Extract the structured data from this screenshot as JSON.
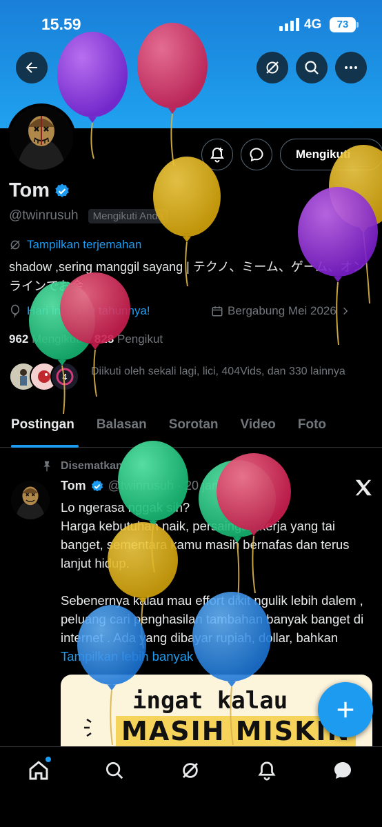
{
  "status_bar": {
    "time": "15.59",
    "network": "4G",
    "battery": "73"
  },
  "profile": {
    "name": "Tom",
    "handle": "@twinrusuh",
    "follows_you": "Mengikuti Anda",
    "follow_button": "Mengikuti",
    "translate": "Tampilkan terjemahan",
    "bio": "shadow ,sering manggil sayang | テクノ、ミーム、ゲーム、オンラインでお金",
    "birthday": "Hari ini ulang tahunnya!",
    "joined": "Bergabung Mei 2026",
    "following_count": "962",
    "following_label": "Mengikuti",
    "followers_count": "828",
    "followers_label": "Pengikut",
    "followed_by": "Diikuti oleh sekali lagi, lici, 404Vids, dan 330 lainnya"
  },
  "tabs": [
    {
      "label": "Postingan"
    },
    {
      "label": "Balasan"
    },
    {
      "label": "Sorotan"
    },
    {
      "label": "Video"
    },
    {
      "label": "Foto"
    }
  ],
  "tweet": {
    "pinned": "Disematkan",
    "name": "Tom",
    "handle": "@twinrusuh · 20 jam",
    "body": "Lo ngerasa nggak sih?\nHarga kebutuhan naik, persaingan kerja yang tai banget, sementara kamu masih bernafas dan terus lanjut hidup.\n\nSebenernya kalau mau effort dikit ngulik lebih dalem , peluang cari penghasilan tambahan banyak banget di internet . Ada yang dibayar rupiah, dollar, bahkan ",
    "show_more": "Tampilkan lebih banyak",
    "image_text_1": "ingat kalau",
    "image_text_2": "MASIH MISKIN"
  },
  "colors": {
    "accent": "#1d9bf0",
    "banner": "#1d94e6",
    "background": "#000000",
    "muted": "#71767b"
  },
  "icons": [
    "back-icon",
    "grok-icon",
    "search-icon",
    "more-icon",
    "bell-plus-icon",
    "message-icon",
    "verified-icon",
    "translate-icon",
    "balloon-icon",
    "calendar-icon",
    "chevron-right-icon",
    "pin-icon",
    "x-logo-icon",
    "plus-icon",
    "home-icon",
    "explore-icon",
    "notifications-icon",
    "messages-icon"
  ]
}
